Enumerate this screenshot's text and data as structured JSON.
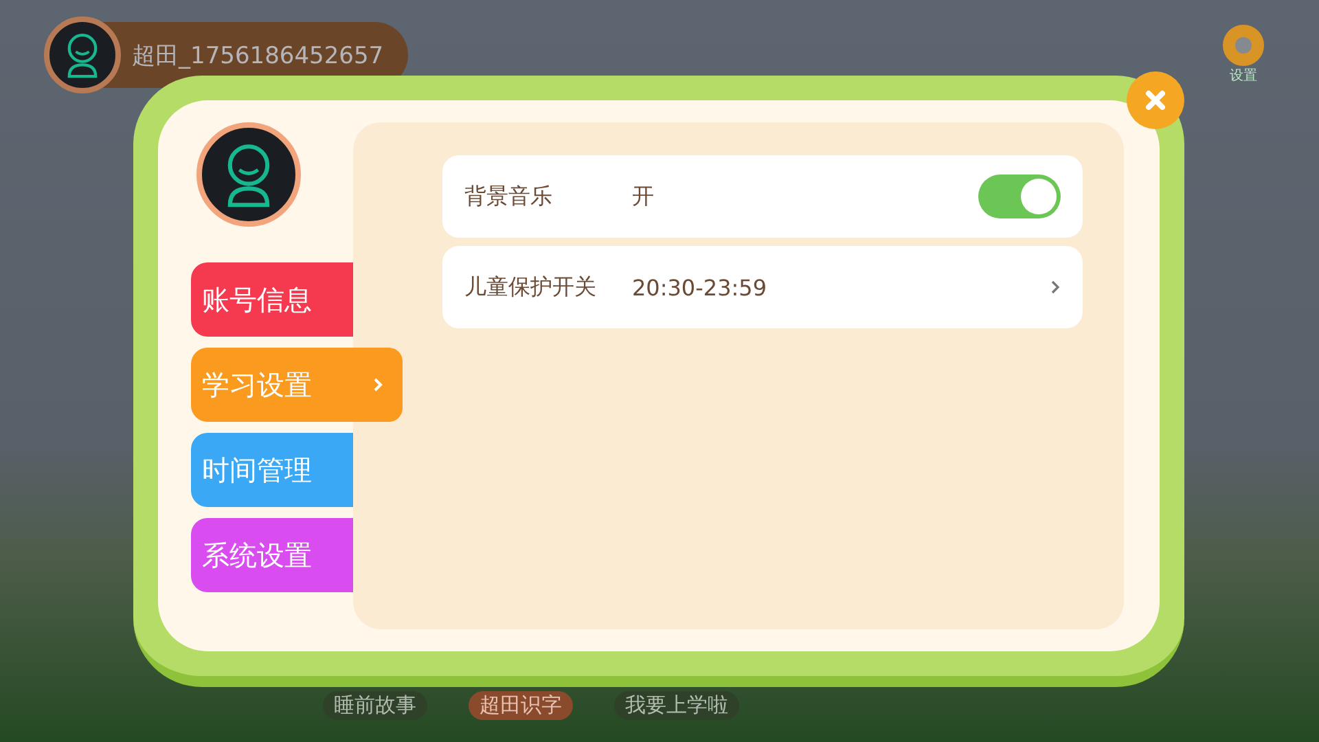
{
  "user": {
    "name": "超田_1756186452657"
  },
  "settings_button": {
    "label": "设置"
  },
  "bottom_tabs": [
    {
      "label": "睡前故事",
      "selected": false
    },
    {
      "label": "超田识字",
      "selected": true
    },
    {
      "label": "我要上学啦",
      "selected": false
    }
  ],
  "dialog": {
    "tabs": [
      {
        "label": "账号信息",
        "color": "#f5394f",
        "selected": false
      },
      {
        "label": "学习设置",
        "color": "#fa9a1e",
        "selected": true
      },
      {
        "label": "时间管理",
        "color": "#3aa8f5",
        "selected": false
      },
      {
        "label": "系统设置",
        "color": "#d84cf0",
        "selected": false
      }
    ],
    "rows": [
      {
        "kind": "toggle",
        "label": "背景音乐",
        "value": "开",
        "on": true
      },
      {
        "kind": "link",
        "label": "儿童保护开关",
        "value": "20:30-23:59"
      }
    ]
  }
}
